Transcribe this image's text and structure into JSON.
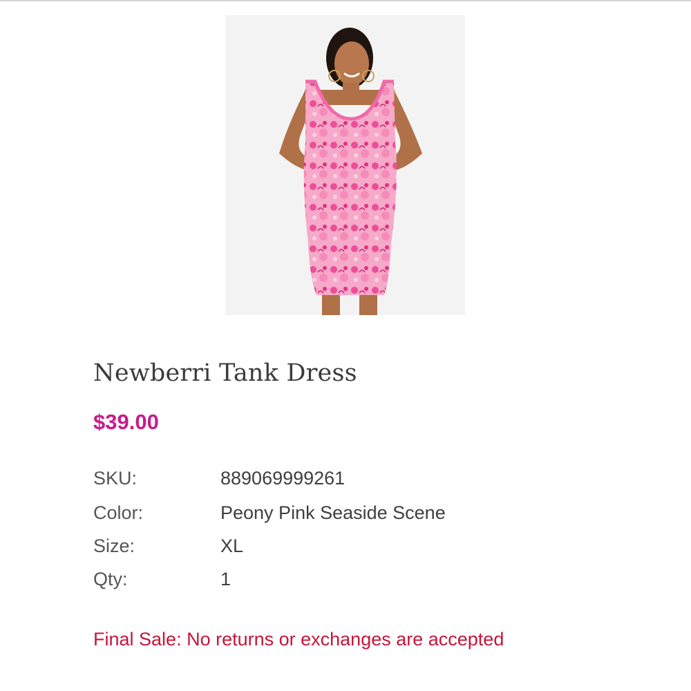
{
  "product": {
    "name": "Newberri Tank Dress",
    "price": "$39.00",
    "image_alt": "Woman wearing a pink floral print tank dress"
  },
  "details": [
    {
      "label": "SKU:",
      "value": "889069999261"
    },
    {
      "label": "Color:",
      "value": "Peony Pink Seaside Scene"
    },
    {
      "label": "Size:",
      "value": "XL"
    },
    {
      "label": "Qty:",
      "value": "1"
    }
  ],
  "notice": {
    "final_sale": "Final Sale: No returns or exchanges are accepted"
  },
  "colors": {
    "price": "#c81b8c",
    "final_sale": "#c4163a",
    "dress_pink": "#f07bb0"
  }
}
